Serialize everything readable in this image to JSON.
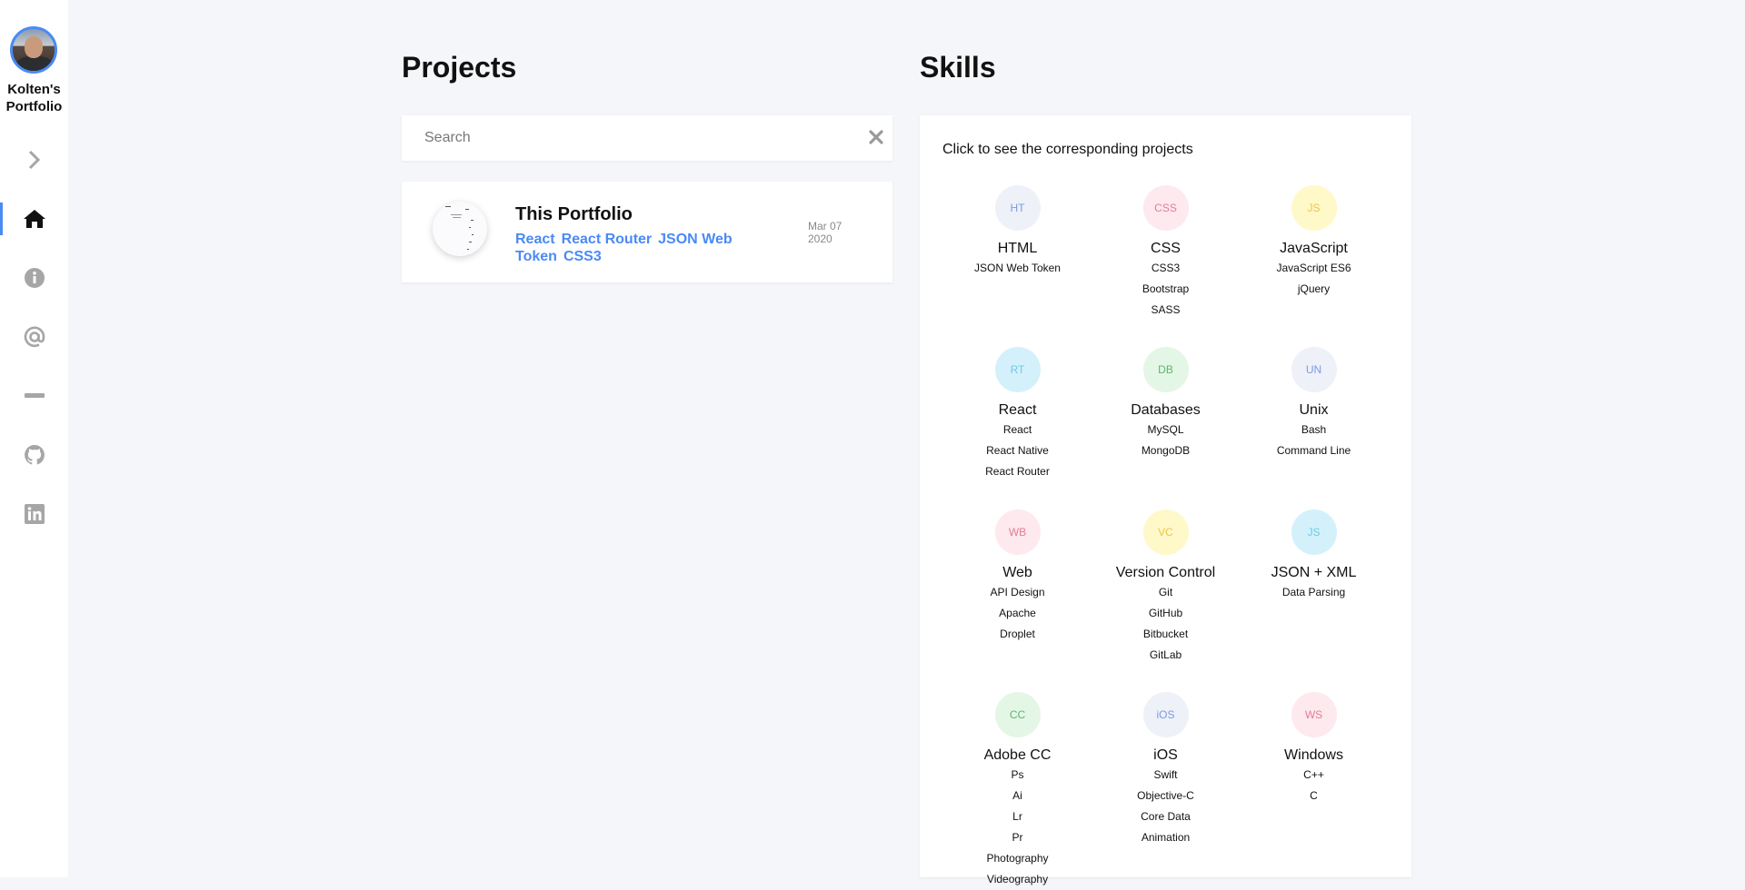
{
  "sidebar": {
    "brand": "Kolten's Portfolio",
    "nav": [
      {
        "name": "expand",
        "icon": "chevron-right-icon"
      },
      {
        "name": "home",
        "icon": "home-icon",
        "active": true
      },
      {
        "name": "about",
        "icon": "info-icon"
      },
      {
        "name": "contact",
        "icon": "at-icon"
      },
      {
        "name": "divider",
        "icon": "minus-icon"
      },
      {
        "name": "github",
        "icon": "github-icon"
      },
      {
        "name": "linkedin",
        "icon": "linkedin-icon"
      }
    ]
  },
  "projects": {
    "heading": "Projects",
    "search_placeholder": "Search",
    "items": [
      {
        "title": "This Portfolio",
        "tags": [
          "React",
          "React Router",
          "JSON Web Token",
          "CSS3"
        ],
        "date_line1": "Mar 07",
        "date_line2": "2020"
      }
    ]
  },
  "skills": {
    "heading": "Skills",
    "hint": "Click to see the corresponding projects",
    "items": [
      {
        "abbr": "HT",
        "name": "HTML",
        "subs": [
          "JSON Web Token"
        ],
        "bg": "#eef1f8",
        "fg": "#7a9be0"
      },
      {
        "abbr": "CSS",
        "name": "CSS",
        "subs": [
          "CSS3",
          "Bootstrap",
          "SASS"
        ],
        "bg": "#fde9ee",
        "fg": "#e57d96"
      },
      {
        "abbr": "JS",
        "name": "JavaScript",
        "subs": [
          "JavaScript ES6",
          "jQuery"
        ],
        "bg": "#fff8c9",
        "fg": "#e8c84a"
      },
      {
        "abbr": "RT",
        "name": "React",
        "subs": [
          "React",
          "React Native",
          "React Router"
        ],
        "bg": "#d4f1fb",
        "fg": "#6bcbe8"
      },
      {
        "abbr": "DB",
        "name": "Databases",
        "subs": [
          "MySQL",
          "MongoDB"
        ],
        "bg": "#e4f6e6",
        "fg": "#5cb86a"
      },
      {
        "abbr": "UN",
        "name": "Unix",
        "subs": [
          "Bash",
          "Command Line"
        ],
        "bg": "#eef1f8",
        "fg": "#7a9be0"
      },
      {
        "abbr": "WB",
        "name": "Web",
        "subs": [
          "API Design",
          "Apache",
          "Droplet"
        ],
        "bg": "#fde9ee",
        "fg": "#e57d96"
      },
      {
        "abbr": "VC",
        "name": "Version Control",
        "subs": [
          "Git",
          "GitHub",
          "Bitbucket",
          "GitLab"
        ],
        "bg": "#fff8c9",
        "fg": "#e8c84a"
      },
      {
        "abbr": "JS",
        "name": "JSON + XML",
        "subs": [
          "Data Parsing"
        ],
        "bg": "#d4f1fb",
        "fg": "#6bcbe8"
      },
      {
        "abbr": "CC",
        "name": "Adobe CC",
        "subs": [
          "Ps",
          "Ai",
          "Lr",
          "Pr",
          "Photography",
          "Videography"
        ],
        "bg": "#e4f6e6",
        "fg": "#5cb86a"
      },
      {
        "abbr": "iOS",
        "name": "iOS",
        "subs": [
          "Swift",
          "Objective-C",
          "Core Data",
          "Animation"
        ],
        "bg": "#eef1f8",
        "fg": "#7a9be0"
      },
      {
        "abbr": "WS",
        "name": "Windows",
        "subs": [
          "C++",
          "C"
        ],
        "bg": "#fde9ee",
        "fg": "#e57d96"
      }
    ]
  }
}
